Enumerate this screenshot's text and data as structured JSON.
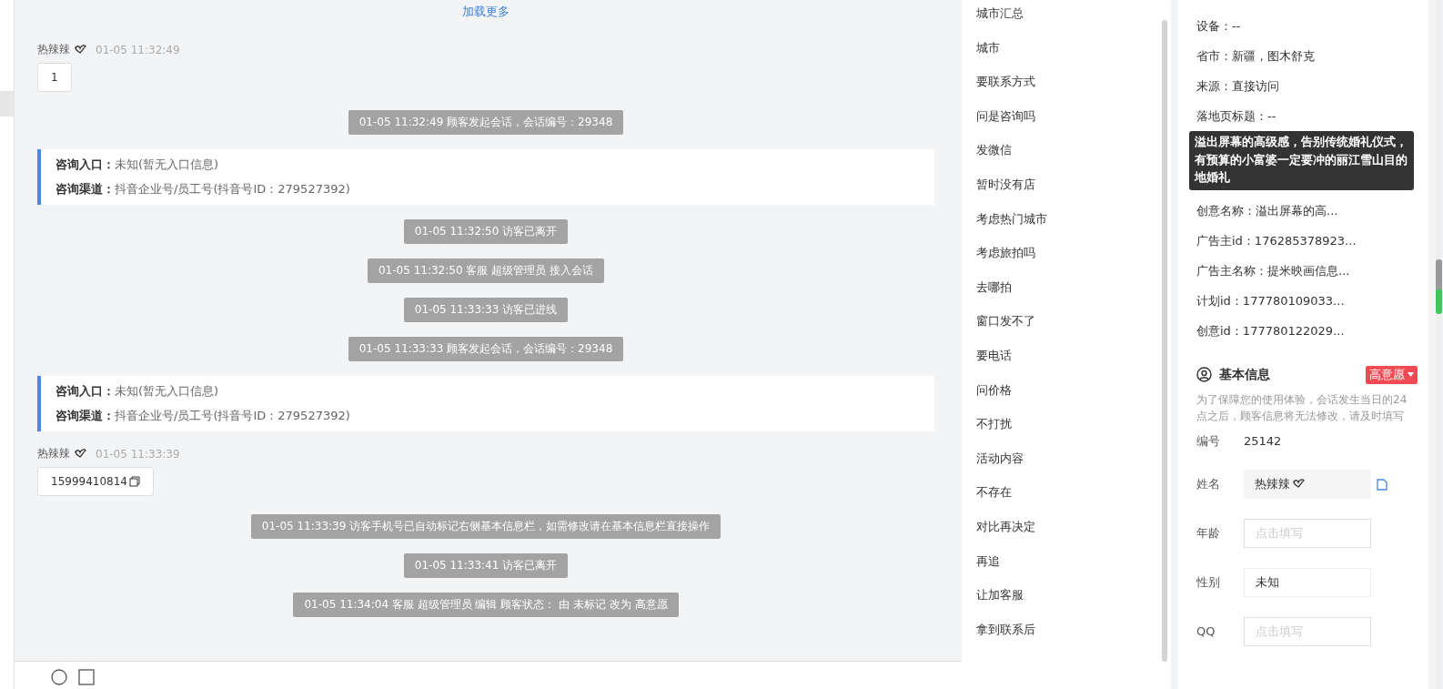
{
  "chat": {
    "load_more": "加载更多",
    "messages": [
      {
        "kind": "visitor",
        "name": "热辣辣",
        "time": "01-05 11:32:49",
        "text": "1",
        "copyable": false
      },
      {
        "kind": "system",
        "text": "01-05 11:32:49 顾客发起会话，会话编号：29348"
      },
      {
        "kind": "entry",
        "lines": [
          {
            "label": "咨询入口：",
            "value": "未知(暂无入口信息)"
          },
          {
            "label": "咨询渠道：",
            "value": "抖音企业号/员工号(抖音号ID：279527392)"
          }
        ]
      },
      {
        "kind": "system",
        "text": "01-05 11:32:50 访客已离开"
      },
      {
        "kind": "system",
        "text": "01-05 11:32:50 客服 超级管理员 接入会话"
      },
      {
        "kind": "system",
        "text": "01-05 11:33:33 访客已进线"
      },
      {
        "kind": "system",
        "text": "01-05 11:33:33 顾客发起会话，会话编号：29348"
      },
      {
        "kind": "entry",
        "lines": [
          {
            "label": "咨询入口：",
            "value": "未知(暂无入口信息)"
          },
          {
            "label": "咨询渠道：",
            "value": "抖音企业号/员工号(抖音号ID：279527392)"
          }
        ]
      },
      {
        "kind": "visitor",
        "name": "热辣辣",
        "time": "01-05 11:33:39",
        "text": "15999410814",
        "copyable": true
      },
      {
        "kind": "system",
        "text": "01-05 11:33:39 访客手机号已自动标记右侧基本信息栏，如需修改请在基本信息栏直接操作"
      },
      {
        "kind": "system",
        "text": "01-05 11:33:41 访客已离开"
      },
      {
        "kind": "system",
        "text": "01-05 11:34:04 客服 超级管理员 编辑 顾客状态： 由 未标记 改为 高意愿"
      }
    ]
  },
  "quick_replies": [
    "城市汇总",
    "城市",
    "要联系方式",
    "问是咨询吗",
    "发微信",
    "暂时没有店",
    "考虑热门城市",
    "考虑旅拍吗",
    "去哪拍",
    "窗口发不了",
    "要电话",
    "问价格",
    "不打扰",
    "活动内容",
    "不存在",
    "对比再决定",
    "再追",
    "让加客服",
    "拿到联系后"
  ],
  "visit_info": {
    "rows_above": [
      "设备：--",
      "省市：新疆，图木舒克",
      "来源：直接访问",
      "落地页标题：--"
    ],
    "tooltip": "溢出屏幕的高级感，告别传统婚礼仪式，有预算的小富婆一定要冲的丽江雪山目的地婚礼",
    "rows_below": [
      "创意名称：溢出屏幕的高...",
      "广告主id：176285378923...",
      "广告主名称：提米映画信息...",
      "计划id：177780109033...",
      "创意id：177780122029..."
    ]
  },
  "basic_info": {
    "title": "基本信息",
    "status": "高意愿",
    "notice": "为了保障您的使用体验，会话发生当日的24点之后，顾客信息将无法修改，请及时填写",
    "fields": [
      {
        "kind": "text",
        "label": "编号",
        "value": "25142"
      },
      {
        "kind": "readonly",
        "label": "姓名",
        "value": "热辣辣"
      },
      {
        "kind": "input",
        "label": "年龄",
        "placeholder": "点击填写"
      },
      {
        "kind": "select",
        "label": "性别",
        "value": "未知"
      },
      {
        "kind": "input",
        "label": "QQ",
        "placeholder": "点击填写"
      }
    ]
  }
}
